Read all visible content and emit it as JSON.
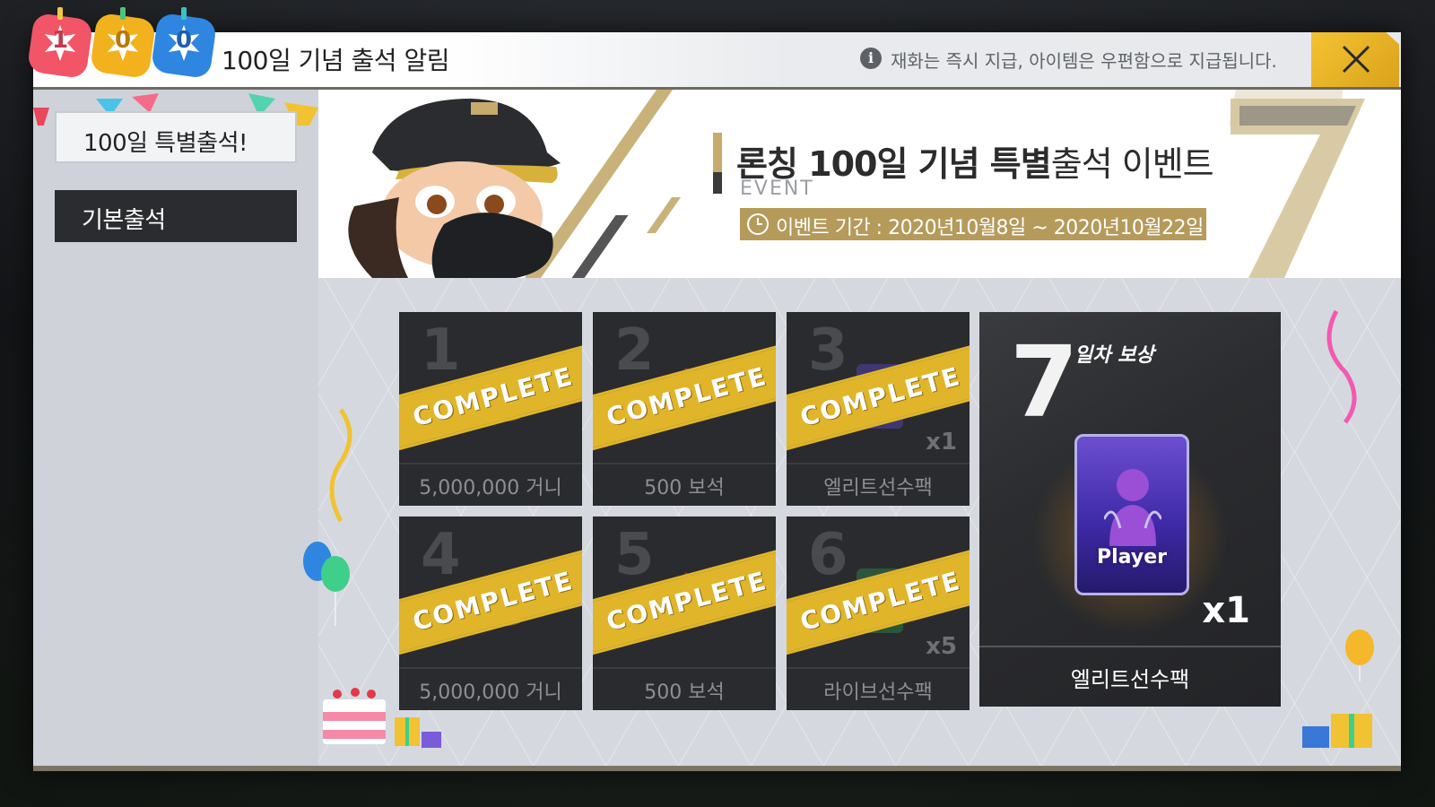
{
  "header": {
    "badges": [
      "1",
      "0",
      "0"
    ],
    "title": "100일 기념 출석 알림",
    "info_text": "재화는 즉시 지급, 아이템은 우편함으로 지급됩니다.",
    "close_label": "close"
  },
  "sidebar": {
    "items": [
      {
        "label": "100일 특별출석!",
        "active": true
      },
      {
        "label": "기본출석",
        "active": false
      }
    ]
  },
  "banner": {
    "title_bold": "론칭 100일 기념 특별",
    "title_rest": "출석 이벤트",
    "subtitle": "EVENT",
    "period": "이벤트 기간 : 2020년10월8일 ~ 2020년10월22일"
  },
  "rewards": [
    {
      "day": "1",
      "label": "5,000,000 거니",
      "qty": "",
      "status": "COMPLETE",
      "icon": "coins-icon"
    },
    {
      "day": "2",
      "label": "500 보석",
      "qty": "",
      "status": "COMPLETE",
      "icon": "gems-icon"
    },
    {
      "day": "3",
      "label": "엘리트선수팩",
      "qty": "x1",
      "status": "COMPLETE",
      "icon": "elite-pack-icon"
    },
    {
      "day": "4",
      "label": "5,000,000 거니",
      "qty": "",
      "status": "COMPLETE",
      "icon": "coins-icon"
    },
    {
      "day": "5",
      "label": "500 보석",
      "qty": "",
      "status": "COMPLETE",
      "icon": "gems-icon"
    },
    {
      "day": "6",
      "label": "라이브선수팩",
      "qty": "x5",
      "status": "COMPLETE",
      "icon": "live-pack-icon"
    }
  ],
  "final_reward": {
    "day": "7",
    "day_label": "일차 보상",
    "pack_text": "Player",
    "qty": "x1",
    "name": "엘리트선수팩"
  },
  "colors": {
    "accent_gold": "#e0b52a",
    "card_dark": "#2a2b2e",
    "banner_gold": "#b59a5a"
  }
}
